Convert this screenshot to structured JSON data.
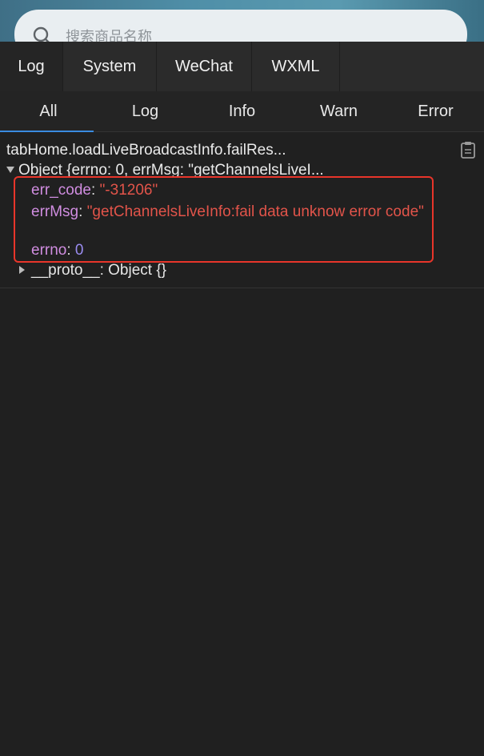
{
  "search": {
    "placeholder": "搜索商品名称"
  },
  "top_tabs": [
    {
      "label": "Log"
    },
    {
      "label": "System"
    },
    {
      "label": "WeChat"
    },
    {
      "label": "WXML"
    }
  ],
  "level_tabs": [
    {
      "label": "All",
      "active": true
    },
    {
      "label": "Log"
    },
    {
      "label": "Info"
    },
    {
      "label": "Warn"
    },
    {
      "label": "Error"
    }
  ],
  "log": {
    "title": "tabHome.loadLiveBroadcastInfo.failRes...",
    "object_summary": "Object {errno: 0, errMsg: \"getChannelsLiveI...",
    "properties": [
      {
        "key": "err_code",
        "value": "\"-31206\""
      },
      {
        "key": "errMsg",
        "value": "\"getChannelsLiveInfo:fail data unknow error code\""
      },
      {
        "key": "errno",
        "value": "0"
      }
    ],
    "proto_key": "__proto__",
    "proto_value": "Object {}"
  },
  "colors": {
    "accent": "#3a8be0",
    "highlight": "#e8352a",
    "key": "#d08de0",
    "string": "#e2544a",
    "number": "#9a8cf0"
  }
}
